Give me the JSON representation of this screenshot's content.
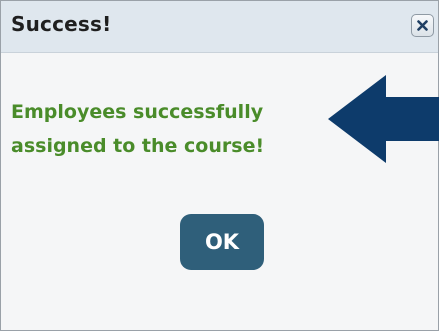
{
  "dialog": {
    "title": "Success!",
    "message_line1": "Employees successfully",
    "message_line2": "assigned to the course!",
    "ok_label": "OK",
    "close_icon": "close-icon",
    "pointer_icon": "left-arrow-icon"
  },
  "colors": {
    "title_bar": "#dfe7ee",
    "message_text": "#4a8c2a",
    "ok_button": "#2f5f7a",
    "arrow": "#0d3b6b"
  }
}
